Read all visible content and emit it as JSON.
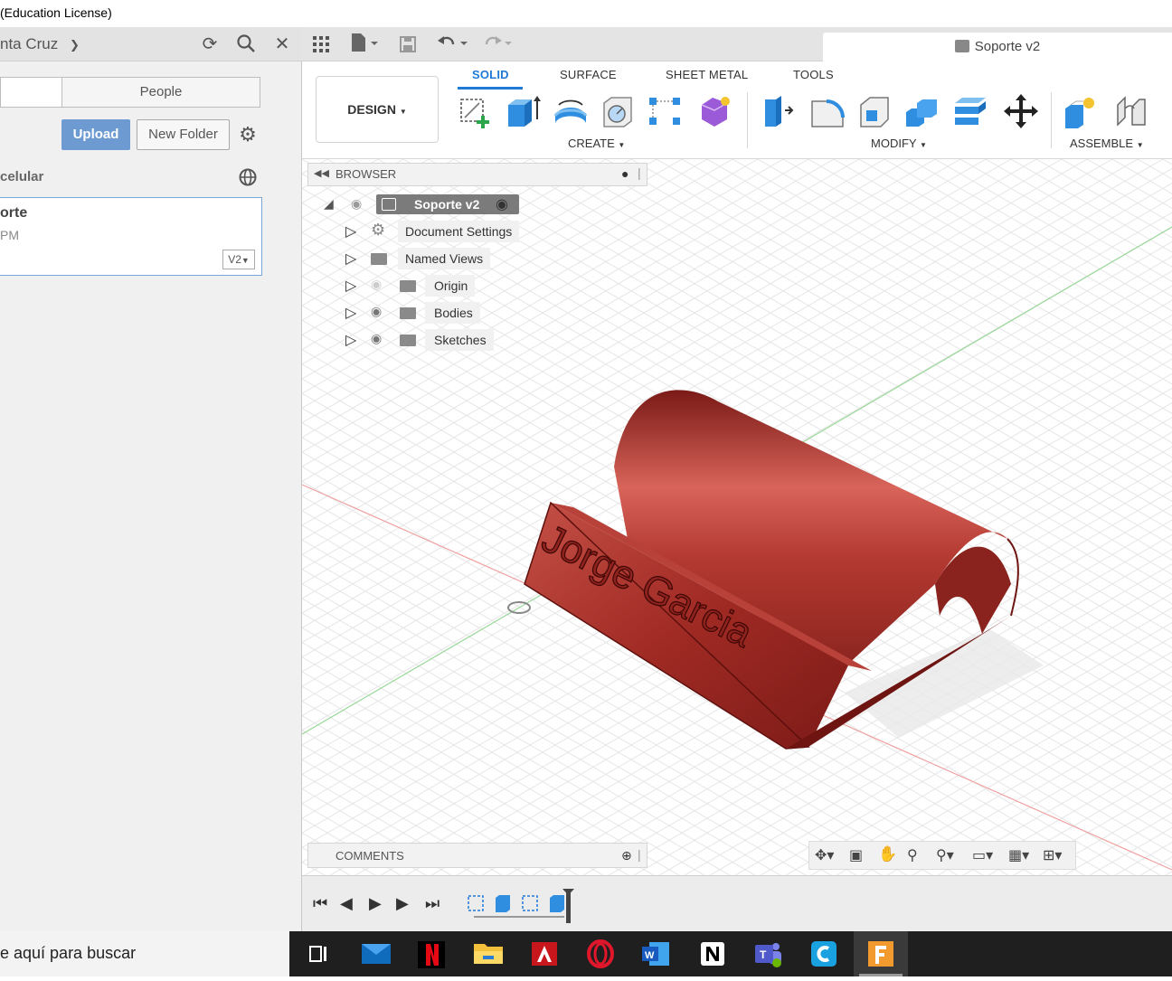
{
  "window": {
    "title": "(Education License)"
  },
  "data_panel": {
    "project_name": "nta Cruz",
    "tabs": [
      {
        "label": ""
      },
      {
        "label": "People"
      }
    ],
    "upload_label": "Upload",
    "new_folder_label": "New Folder",
    "folder_name": "celular",
    "file": {
      "name": "orte",
      "time": "PM",
      "version": "V2"
    }
  },
  "document": {
    "tab_title": "Soporte v2"
  },
  "ribbon": {
    "tabs": [
      "SOLID",
      "SURFACE",
      "SHEET METAL",
      "TOOLS"
    ],
    "active_tab": "SOLID",
    "workspace_label": "DESIGN",
    "groups": [
      "CREATE",
      "MODIFY",
      "ASSEMBLE"
    ]
  },
  "browser": {
    "title": "BROWSER",
    "root": "Soporte v2",
    "items": [
      "Document Settings",
      "Named Views",
      "Origin",
      "Bodies",
      "Sketches"
    ]
  },
  "model": {
    "embossed_text": "Jorge Garcia",
    "color": "#a8302a"
  },
  "comments": {
    "title": "COMMENTS"
  },
  "taskbar": {
    "search_text": "e aquí para buscar",
    "apps": [
      "task-view",
      "mail",
      "netflix",
      "file-explorer",
      "autocad",
      "opera",
      "word",
      "notion",
      "teams",
      "cx",
      "fusion-360"
    ]
  },
  "colors": {
    "accent": "#1f79d6",
    "upload": "#6d9bd1",
    "taskbar": "#1f1f1f"
  }
}
